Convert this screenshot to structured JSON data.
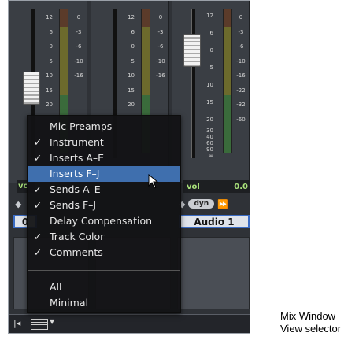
{
  "strips": [
    {
      "scale": [
        "12",
        "6",
        "0",
        "5",
        "10",
        "15",
        "20"
      ],
      "meter_scale": [
        "0",
        "-3",
        "-6",
        "-10",
        "-16"
      ]
    },
    {
      "scale": [
        "12",
        "6",
        "0",
        "5",
        "10",
        "15",
        "20"
      ],
      "meter_scale": [
        "0",
        "-3",
        "-6",
        "-10",
        "-16"
      ]
    },
    {
      "scale": [
        "12",
        "6",
        "0",
        "5",
        "10",
        "15",
        "20",
        "30",
        "40",
        "60",
        "90",
        "∞"
      ],
      "meter_scale": [
        "0",
        "-3",
        "-6",
        "-10",
        "-16",
        "-22",
        "-32",
        "-60"
      ]
    }
  ],
  "vol_label": "vol",
  "vol_value": "0.0",
  "vol_label_left": "vo",
  "dyn_label": "dyn",
  "track_name": "Audio 1",
  "track_name_left": "0",
  "menu": {
    "items": [
      {
        "label": "Mic Preamps",
        "checked": false,
        "check": ""
      },
      {
        "label": "Instrument",
        "checked": true,
        "check": "✓"
      },
      {
        "label": "Inserts A–E",
        "checked": true,
        "check": "✓"
      },
      {
        "label": "Inserts F–J",
        "checked": false,
        "check": "",
        "highlighted": true
      },
      {
        "label": "Sends A–E",
        "checked": true,
        "check": "✓"
      },
      {
        "label": "Sends F–J",
        "checked": true,
        "check": "✓"
      },
      {
        "label": "Delay Compensation",
        "checked": false,
        "check": ""
      },
      {
        "label": "Track Color",
        "checked": true,
        "check": "✓"
      },
      {
        "label": "Comments",
        "checked": true,
        "check": "✓"
      }
    ],
    "items2": [
      {
        "label": "All"
      },
      {
        "label": "Minimal"
      }
    ]
  },
  "callout": {
    "line1": "Mix Window",
    "line2": "View selector"
  }
}
